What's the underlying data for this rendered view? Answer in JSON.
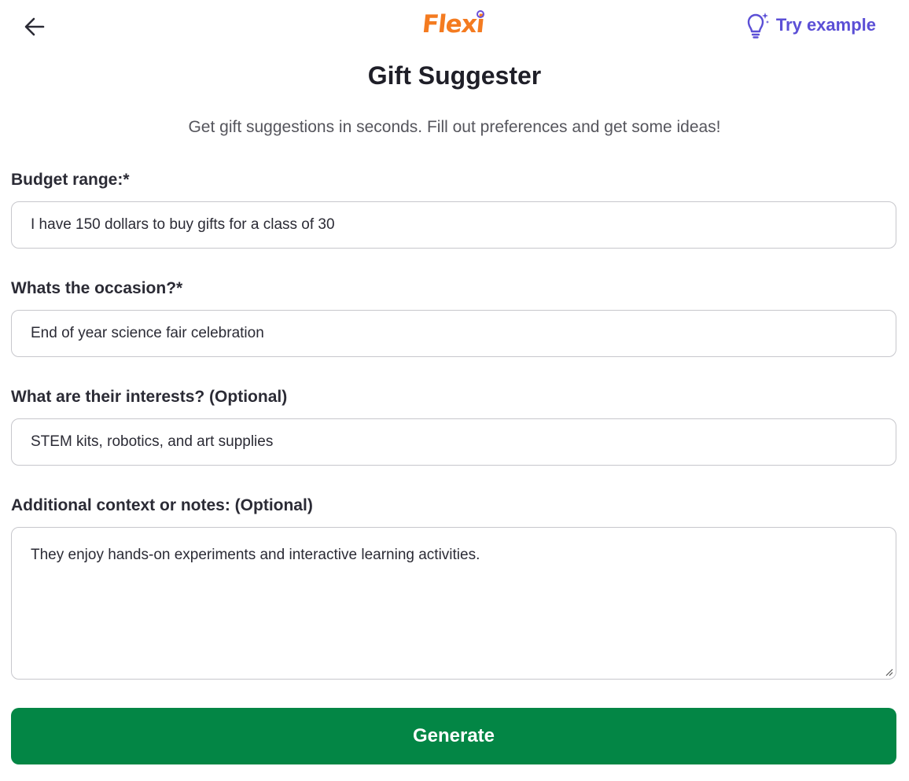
{
  "header": {
    "logo_text": "Flexi",
    "try_example_label": "Try example",
    "accent_color": "#5b4fd6",
    "logo_color": "#f47b20"
  },
  "page": {
    "title": "Gift Suggester",
    "subtitle": "Get gift suggestions in seconds. Fill out preferences and get some ideas!"
  },
  "form": {
    "budget": {
      "label": "Budget range:*",
      "value": "I have 150 dollars to buy gifts for a class of 30"
    },
    "occasion": {
      "label": "Whats the occasion?*",
      "value": "End of year science fair celebration"
    },
    "interests": {
      "label": "What are their interests? (Optional)",
      "value": "STEM kits, robotics, and art supplies"
    },
    "notes": {
      "label": "Additional context or notes: (Optional)",
      "value": "They enjoy hands-on experiments and interactive learning activities."
    },
    "generate_label": "Generate",
    "generate_color": "#038645"
  },
  "icons": {
    "back": "arrow-left-icon",
    "try_example": "lightbulb-sparkle-icon"
  }
}
